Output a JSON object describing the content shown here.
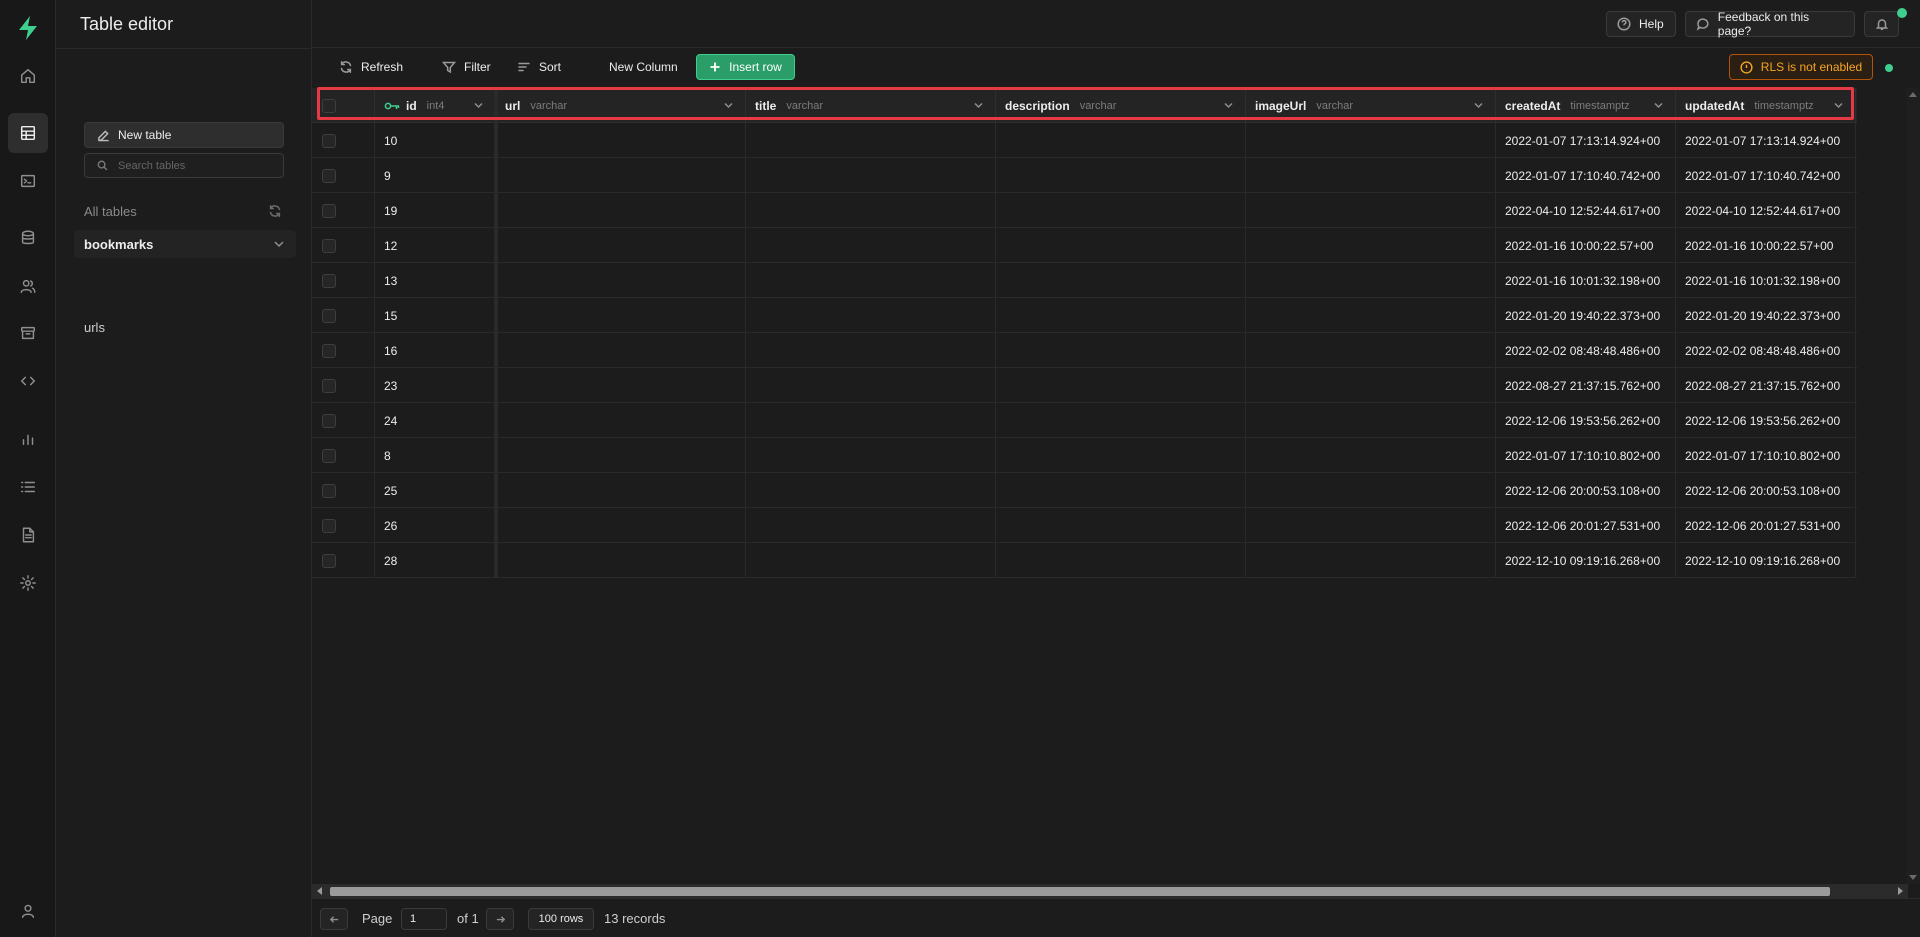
{
  "sidebar": {
    "title": "Table editor",
    "new_table_label": "New table",
    "search_placeholder": "Search tables",
    "all_tables_label": "All tables",
    "schema": "bookmarks",
    "tables": [
      "urls"
    ]
  },
  "topbar": {
    "help_label": "Help",
    "feedback_label": "Feedback on this page?"
  },
  "toolbar": {
    "refresh_label": "Refresh",
    "filter_label": "Filter",
    "sort_label": "Sort",
    "new_column_label": "New Column",
    "insert_row_label": "Insert row",
    "rls_label": "RLS is not enabled"
  },
  "grid": {
    "columns": [
      {
        "name": "id",
        "type": "int4",
        "primary_key": true
      },
      {
        "name": "url",
        "type": "varchar"
      },
      {
        "name": "title",
        "type": "varchar"
      },
      {
        "name": "description",
        "type": "varchar"
      },
      {
        "name": "imageUrl",
        "type": "varchar"
      },
      {
        "name": "createdAt",
        "type": "timestamptz"
      },
      {
        "name": "updatedAt",
        "type": "timestamptz"
      }
    ],
    "rows": [
      {
        "id": "10",
        "createdAt": "2022-01-07 17:13:14.924+00",
        "updatedAt": "2022-01-07 17:13:14.924+00"
      },
      {
        "id": "9",
        "createdAt": "2022-01-07 17:10:40.742+00",
        "updatedAt": "2022-01-07 17:10:40.742+00"
      },
      {
        "id": "19",
        "createdAt": "2022-04-10 12:52:44.617+00",
        "updatedAt": "2022-04-10 12:52:44.617+00"
      },
      {
        "id": "12",
        "createdAt": "2022-01-16 10:00:22.57+00",
        "updatedAt": "2022-01-16 10:00:22.57+00"
      },
      {
        "id": "13",
        "createdAt": "2022-01-16 10:01:32.198+00",
        "updatedAt": "2022-01-16 10:01:32.198+00"
      },
      {
        "id": "15",
        "createdAt": "2022-01-20 19:40:22.373+00",
        "updatedAt": "2022-01-20 19:40:22.373+00"
      },
      {
        "id": "16",
        "createdAt": "2022-02-02 08:48:48.486+00",
        "updatedAt": "2022-02-02 08:48:48.486+00"
      },
      {
        "id": "23",
        "createdAt": "2022-08-27 21:37:15.762+00",
        "updatedAt": "2022-08-27 21:37:15.762+00"
      },
      {
        "id": "24",
        "createdAt": "2022-12-06 19:53:56.262+00",
        "updatedAt": "2022-12-06 19:53:56.262+00"
      },
      {
        "id": "8",
        "createdAt": "2022-01-07 17:10:10.802+00",
        "updatedAt": "2022-01-07 17:10:10.802+00"
      },
      {
        "id": "25",
        "createdAt": "2022-12-06 20:00:53.108+00",
        "updatedAt": "2022-12-06 20:00:53.108+00"
      },
      {
        "id": "26",
        "createdAt": "2022-12-06 20:01:27.531+00",
        "updatedAt": "2022-12-06 20:01:27.531+00"
      },
      {
        "id": "28",
        "createdAt": "2022-12-10 09:19:16.268+00",
        "updatedAt": "2022-12-10 09:19:16.268+00"
      }
    ]
  },
  "footer": {
    "page_label": "Page",
    "page_value": "1",
    "of_label": "of 1",
    "rows_label": "100 rows",
    "records_label": "13 records"
  },
  "icons": {
    "rail": [
      "home-icon",
      "table-editor-icon",
      "sql-editor-icon",
      "database-icon",
      "auth-icon",
      "storage-icon",
      "edge-functions-icon",
      "reports-icon",
      "logs-icon",
      "api-docs-icon",
      "settings-icon",
      "user-icon"
    ]
  },
  "colors": {
    "accent": "#3ecf8e",
    "warning": "#f5a524",
    "highlight": "#e63946"
  }
}
